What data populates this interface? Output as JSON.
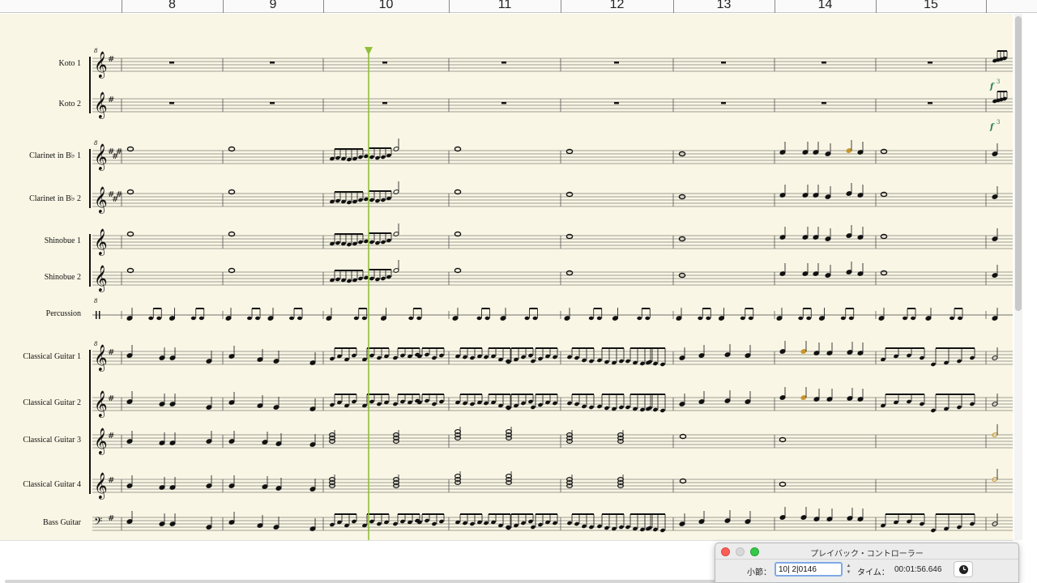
{
  "ruler": {
    "measures": [
      "8",
      "9",
      "10",
      "11",
      "12",
      "13",
      "14",
      "15"
    ]
  },
  "staves": [
    {
      "name": "Koto 1",
      "clef": "treble",
      "key": "1#"
    },
    {
      "name": "Koto 2",
      "clef": "treble",
      "key": "1#"
    },
    {
      "name": "Clarinet in B♭ 1",
      "clef": "treble",
      "key": "3#"
    },
    {
      "name": "Clarinet in B♭ 2",
      "clef": "treble",
      "key": "3#"
    },
    {
      "name": "Shinobue 1",
      "clef": "treble",
      "key": "0"
    },
    {
      "name": "Shinobue 2",
      "clef": "treble",
      "key": "0"
    },
    {
      "name": "Percussion",
      "clef": "percussion",
      "key": "0"
    },
    {
      "name": "Classical Guitar 1",
      "clef": "treble",
      "key": "1#"
    },
    {
      "name": "Classical Guitar 2",
      "clef": "treble",
      "key": "1#"
    },
    {
      "name": "Classical Guitar 3",
      "clef": "treble",
      "key": "1#"
    },
    {
      "name": "Classical Guitar 4",
      "clef": "treble",
      "key": "1#"
    },
    {
      "name": "Bass Guitar",
      "clef": "bass",
      "key": "1#"
    }
  ],
  "score": {
    "dynamic_marks": [
      "f",
      "f"
    ],
    "tuplet_mark": "3",
    "octave_mark": "8"
  },
  "playback_panel": {
    "title": "プレイバック・コントローラー",
    "measure_label": "小節：",
    "measure_value": "10| 2|0146",
    "time_label": "タイム：",
    "time_value": "00:01:56.646"
  },
  "colors": {
    "paper": "#f9f6e5",
    "playhead": "#8fbf3a",
    "highlight_note": "#c8952a"
  }
}
